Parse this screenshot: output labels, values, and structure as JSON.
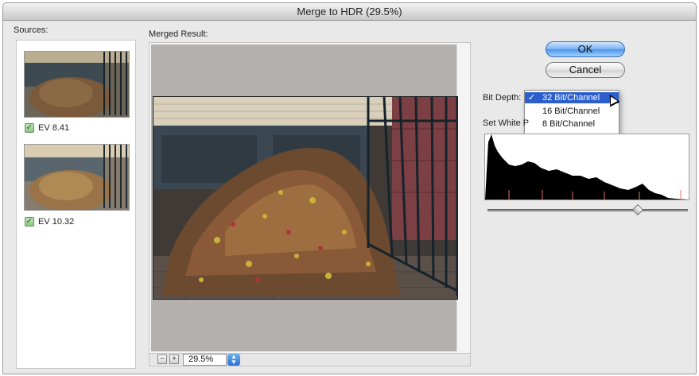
{
  "window": {
    "title": "Merge to HDR (29.5%)"
  },
  "sources": {
    "label": "Sources:",
    "items": [
      {
        "label": "EV 8.41",
        "checked": true
      },
      {
        "label": "EV 10.32",
        "checked": true
      }
    ]
  },
  "preview": {
    "label": "Merged Result:"
  },
  "zoom": {
    "value": "29.5%",
    "zoom_out_glyph": "−",
    "zoom_in_glyph": "+"
  },
  "buttons": {
    "ok": "OK",
    "cancel": "Cancel"
  },
  "bit_depth": {
    "label": "Bit Depth:",
    "options": [
      {
        "label": "32 Bit/Channel",
        "selected": true,
        "check": "✓"
      },
      {
        "label": "16 Bit/Channel",
        "selected": false,
        "check": ""
      },
      {
        "label": "8 Bit/Channel",
        "selected": false,
        "check": ""
      }
    ]
  },
  "white_point": {
    "label": "Set White P",
    "slider_position": 0.75
  },
  "colors": {
    "accent": "#2c5fcd",
    "ok_button": "#4f94ea",
    "window_bg": "#e9e9e9"
  },
  "icons": {
    "check": "checkmark-icon",
    "pointer": "mouse-pointer-icon"
  }
}
